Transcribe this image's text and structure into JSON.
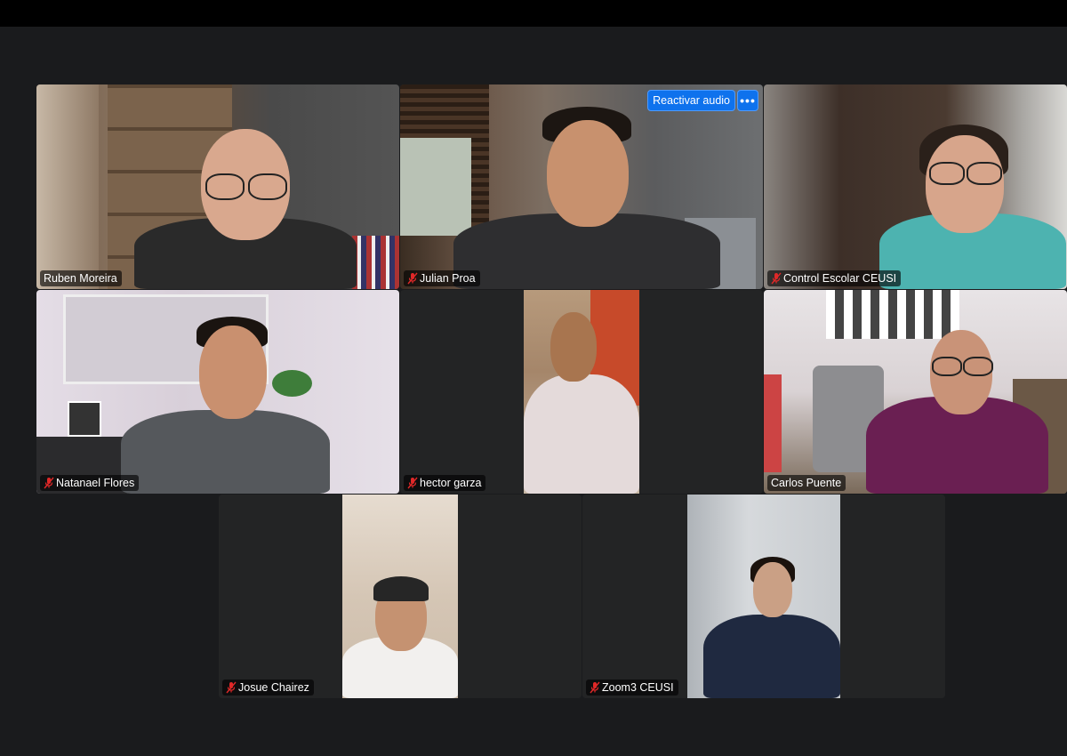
{
  "meeting": {
    "audio_banner": {
      "reactivate_label": "Reactivar audio",
      "more_label": "•••"
    },
    "participants": [
      {
        "name": "Ruben Moreira",
        "muted": false
      },
      {
        "name": "Julian Proa",
        "muted": true
      },
      {
        "name": "Control Escolar CEUSI",
        "muted": true
      },
      {
        "name": "Natanael Flores",
        "muted": true
      },
      {
        "name": "hector garza",
        "muted": true
      },
      {
        "name": "Carlos Puente",
        "muted": false
      },
      {
        "name": "Josue Chairez",
        "muted": true
      },
      {
        "name": "Zoom3 CEUSI",
        "muted": true
      }
    ]
  },
  "colors": {
    "background": "#1a1b1d",
    "tile": "#232425",
    "accent_blue": "#0e72ed",
    "muted_red": "#e02828"
  }
}
